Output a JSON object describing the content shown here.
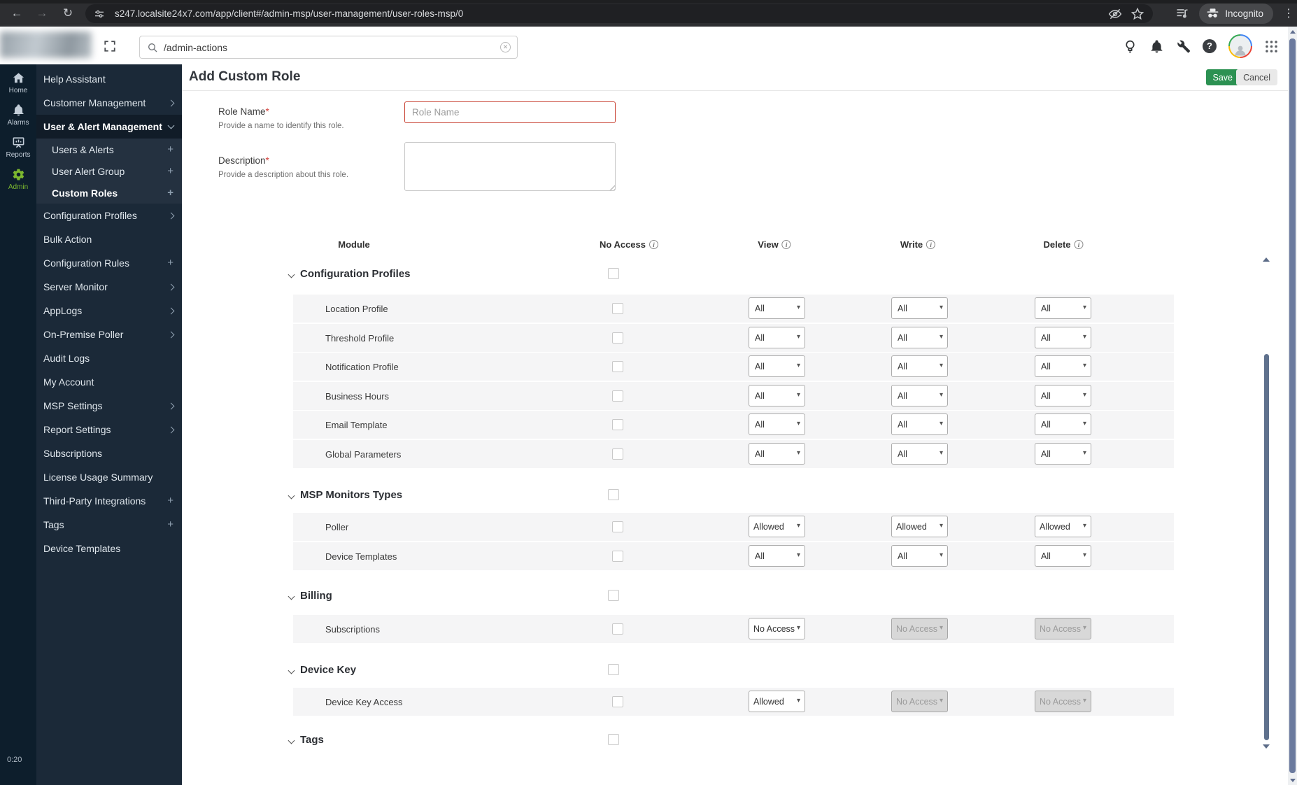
{
  "browser": {
    "url": "s247.localsite24x7.com/app/client#/admin-msp/user-management/user-roles-msp/0",
    "incognito_label": "Incognito"
  },
  "app_header": {
    "search_value": "/admin-actions"
  },
  "rail": {
    "items": [
      {
        "label": "Home"
      },
      {
        "label": "Alarms"
      },
      {
        "label": "Reports"
      },
      {
        "label": "Admin",
        "active": true
      }
    ],
    "timer": "0:20"
  },
  "sidebar": {
    "items": [
      {
        "label": "Help Assistant"
      },
      {
        "label": "Customer Management",
        "expand": "chevron"
      },
      {
        "label": "User & Alert Management",
        "expand": "chevron-down",
        "parent_active": true,
        "bold": true
      },
      {
        "label": "Users & Alerts",
        "sub": true,
        "expand": "plus"
      },
      {
        "label": "User Alert Group",
        "sub": true,
        "expand": "plus"
      },
      {
        "label": "Custom Roles",
        "sub": true,
        "expand": "plus",
        "bold": true
      },
      {
        "label": "Configuration Profiles",
        "expand": "chevron"
      },
      {
        "label": "Bulk Action"
      },
      {
        "label": "Configuration Rules",
        "expand": "plus"
      },
      {
        "label": "Server Monitor",
        "expand": "chevron"
      },
      {
        "label": "AppLogs",
        "expand": "chevron"
      },
      {
        "label": "On-Premise Poller",
        "expand": "chevron"
      },
      {
        "label": "Audit Logs"
      },
      {
        "label": "My Account"
      },
      {
        "label": "MSP Settings",
        "expand": "chevron"
      },
      {
        "label": "Report Settings",
        "expand": "chevron"
      },
      {
        "label": "Subscriptions"
      },
      {
        "label": "License Usage Summary"
      },
      {
        "label": "Third-Party Integrations",
        "expand": "plus"
      },
      {
        "label": "Tags",
        "expand": "plus"
      },
      {
        "label": "Device Templates"
      }
    ]
  },
  "page": {
    "title": "Add Custom Role",
    "save_label": "Save",
    "cancel_label": "Cancel"
  },
  "form": {
    "role_name": {
      "label": "Role Name",
      "required": "*",
      "helper": "Provide a name to identify this role.",
      "placeholder": "Role Name",
      "value": ""
    },
    "description": {
      "label": "Description",
      "required": "*",
      "helper": "Provide a description about this role.",
      "value": ""
    }
  },
  "permissions": {
    "headers": {
      "module": "Module",
      "no_access": "No Access",
      "view": "View",
      "write": "Write",
      "delete": "Delete"
    },
    "sections": [
      {
        "name": "Configuration Profiles",
        "checked": false,
        "rows": [
          {
            "name": "Location Profile",
            "checked": false,
            "view": {
              "value": "All"
            },
            "write": {
              "value": "All"
            },
            "delete": {
              "value": "All"
            }
          },
          {
            "name": "Threshold Profile",
            "checked": false,
            "view": {
              "value": "All"
            },
            "write": {
              "value": "All"
            },
            "delete": {
              "value": "All"
            }
          },
          {
            "name": "Notification Profile",
            "checked": false,
            "view": {
              "value": "All"
            },
            "write": {
              "value": "All"
            },
            "delete": {
              "value": "All"
            }
          },
          {
            "name": "Business Hours",
            "checked": false,
            "view": {
              "value": "All"
            },
            "write": {
              "value": "All"
            },
            "delete": {
              "value": "All"
            }
          },
          {
            "name": "Email Template",
            "checked": false,
            "view": {
              "value": "All"
            },
            "write": {
              "value": "All"
            },
            "delete": {
              "value": "All"
            }
          },
          {
            "name": "Global Parameters",
            "checked": false,
            "view": {
              "value": "All"
            },
            "write": {
              "value": "All"
            },
            "delete": {
              "value": "All"
            }
          }
        ]
      },
      {
        "name": "MSP Monitors Types",
        "checked": false,
        "rows": [
          {
            "name": "Poller",
            "checked": false,
            "view": {
              "value": "Allowed"
            },
            "write": {
              "value": "Allowed"
            },
            "delete": {
              "value": "Allowed"
            }
          },
          {
            "name": "Device Templates",
            "checked": false,
            "view": {
              "value": "All"
            },
            "write": {
              "value": "All"
            },
            "delete": {
              "value": "All"
            }
          }
        ]
      },
      {
        "name": "Billing",
        "checked": false,
        "rows": [
          {
            "name": "Subscriptions",
            "checked": false,
            "view": {
              "value": "No Access"
            },
            "write": {
              "value": "No Access",
              "disabled": true
            },
            "delete": {
              "value": "No Access",
              "disabled": true
            }
          }
        ]
      },
      {
        "name": "Device Key",
        "checked": false,
        "rows": [
          {
            "name": "Device Key Access",
            "checked": false,
            "view": {
              "value": "Allowed"
            },
            "write": {
              "value": "No Access",
              "disabled": true
            },
            "delete": {
              "value": "No Access",
              "disabled": true
            }
          }
        ]
      },
      {
        "name": "Tags",
        "checked": false,
        "rows": []
      }
    ]
  },
  "colors": {
    "save_green": "#2c9152",
    "error_red": "#c94435",
    "rail_bg": "#0d1e2c",
    "sidebar_bg": "#1b2938",
    "admin_green": "#7cb82f",
    "disabled_gray": "#d8d8d8"
  }
}
